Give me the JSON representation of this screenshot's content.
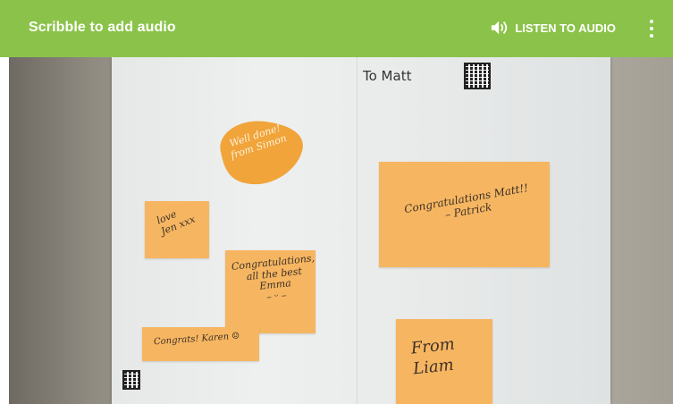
{
  "appbar": {
    "title": "Scribble to add audio",
    "listen_label": "LISTEN TO AUDIO",
    "listen_icon": "speaker-icon",
    "more_icon": "more-vert-icon",
    "bg_color": "#8bc34a"
  },
  "card": {
    "heading": "To Matt",
    "notes": [
      {
        "text": "Well done!\nfrom Simon"
      },
      {
        "text": "love\nJen xxx"
      },
      {
        "text": "Congratulations,\nall the best\nEmma\n– ᵕ –"
      },
      {
        "text": "Congrats! Karen ☺"
      },
      {
        "text": "Congratulations Matt!!\n– Patrick"
      },
      {
        "text": "From\nLiam"
      }
    ]
  }
}
